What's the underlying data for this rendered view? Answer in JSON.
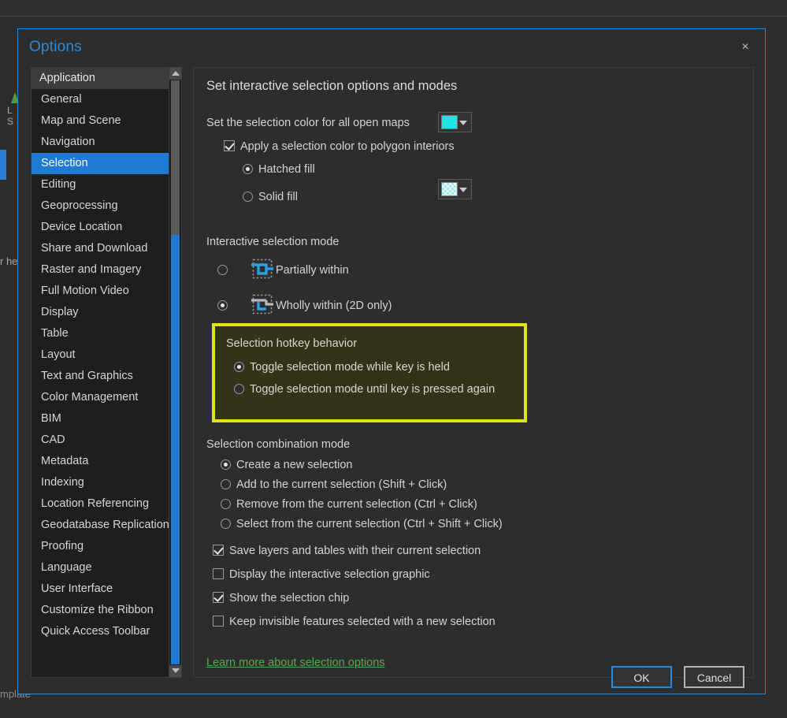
{
  "background": {
    "fragment_left_1": "L",
    "fragment_left_2": "S",
    "fragment_help": "r he",
    "fragment_template": "mplate"
  },
  "dialog": {
    "title": "Options",
    "close_label": "×"
  },
  "sidebar": {
    "header": "Application",
    "items": [
      {
        "label": "General",
        "selected": false
      },
      {
        "label": "Map and Scene",
        "selected": false
      },
      {
        "label": "Navigation",
        "selected": false
      },
      {
        "label": "Selection",
        "selected": true
      },
      {
        "label": "Editing",
        "selected": false
      },
      {
        "label": "Geoprocessing",
        "selected": false
      },
      {
        "label": "Device Location",
        "selected": false
      },
      {
        "label": "Share and Download",
        "selected": false
      },
      {
        "label": "Raster and Imagery",
        "selected": false
      },
      {
        "label": "Full Motion Video",
        "selected": false
      },
      {
        "label": "Display",
        "selected": false
      },
      {
        "label": "Table",
        "selected": false
      },
      {
        "label": "Layout",
        "selected": false
      },
      {
        "label": "Text and Graphics",
        "selected": false
      },
      {
        "label": "Color Management",
        "selected": false
      },
      {
        "label": "BIM",
        "selected": false
      },
      {
        "label": "CAD",
        "selected": false
      },
      {
        "label": "Metadata",
        "selected": false
      },
      {
        "label": "Indexing",
        "selected": false
      },
      {
        "label": "Location Referencing",
        "selected": false
      },
      {
        "label": "Geodatabase Replication",
        "selected": false
      },
      {
        "label": "Proofing",
        "selected": false
      },
      {
        "label": "Language",
        "selected": false
      },
      {
        "label": "User Interface",
        "selected": false
      },
      {
        "label": "Customize the Ribbon",
        "selected": false
      },
      {
        "label": "Quick Access Toolbar",
        "selected": false
      }
    ]
  },
  "content": {
    "title": "Set interactive selection options and modes",
    "selection_color_label": "Set the selection color for all open maps",
    "selection_color_value": "#1ae5e5",
    "apply_polygon_label": "Apply a selection color to polygon interiors",
    "apply_polygon_checked": true,
    "hatched_fill_label": "Hatched fill",
    "solid_fill_label": "Solid fill",
    "fill_mode_selected": "Hatched fill",
    "hatch_swatch_value": "#9fe8ec",
    "interactive_mode_heading": "Interactive selection mode",
    "interactive_modes": [
      {
        "label": "Partially within",
        "selected": false,
        "icon": "partially-within-icon"
      },
      {
        "label": "Wholly within (2D only)",
        "selected": true,
        "icon": "wholly-within-icon"
      }
    ],
    "hotkey": {
      "heading": "Selection hotkey behavior",
      "highlight_color": "#e2e21a",
      "options": [
        {
          "label": "Toggle selection mode while key is held",
          "selected": true
        },
        {
          "label": "Toggle selection mode until key is pressed again",
          "selected": false
        }
      ]
    },
    "combination_heading": "Selection combination mode",
    "combination_options": [
      {
        "label": "Create a new selection",
        "selected": true
      },
      {
        "label": "Add to the current selection (Shift + Click)",
        "selected": false
      },
      {
        "label": "Remove from the current selection (Ctrl + Click)",
        "selected": false
      },
      {
        "label": "Select from the current selection (Ctrl + Shift + Click)",
        "selected": false
      }
    ],
    "checkboxes": [
      {
        "label": "Save layers and tables with their current selection",
        "checked": true
      },
      {
        "label": "Display the interactive selection graphic",
        "checked": false
      },
      {
        "label": "Show the selection chip",
        "checked": true
      },
      {
        "label": "Keep invisible features selected with a new selection",
        "checked": false
      }
    ],
    "learn_more_link": "Learn more about selection options",
    "link_color": "#4bb14b"
  },
  "footer": {
    "ok_label": "OK",
    "cancel_label": "Cancel"
  }
}
